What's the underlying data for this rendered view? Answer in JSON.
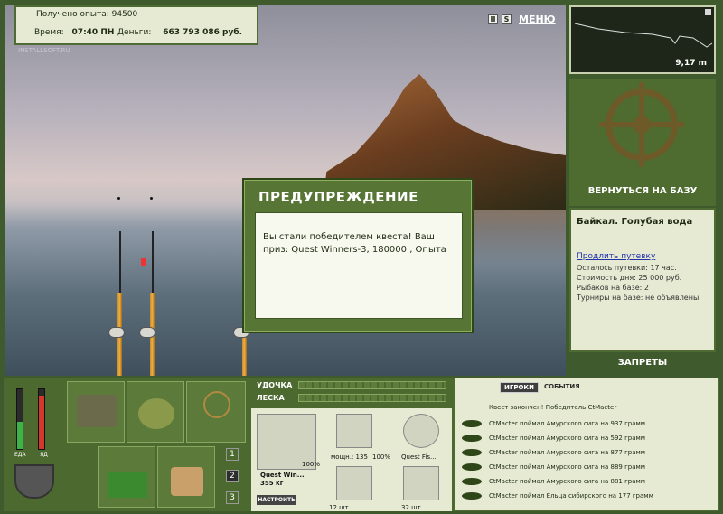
{
  "hud": {
    "experience_label": "Получено опыта:",
    "experience_value": "94500",
    "time_label": "Время:",
    "time_value": "07:40 ПН",
    "money_label": "Деньги:",
    "money_value": "663 793 086 руб.",
    "watermark": "INSTALLSOFT.RU"
  },
  "top_bar": {
    "pause_glyph": "II",
    "sound_glyph": "S",
    "menu_label": "МЕНЮ"
  },
  "depth": {
    "value": "9,17 m"
  },
  "dialog": {
    "title": "ПРЕДУПРЕЖДЕНИЕ",
    "message": "Вы стали победителем квеста! Ваш приз: Quest Winners-3, 180000 , Опыта"
  },
  "right_panel": {
    "return_label": "ВЕРНУТЬСЯ НА БАЗУ",
    "location_title": "Байкал. Голубая вода",
    "extend_link": "Продлить путевку",
    "remaining": "Осталось путевки: 17 час.",
    "day_cost": "Стоимость дня: 25 000 руб.",
    "fishers": "Рыбаков на базе: 2",
    "tournaments": "Турниры на базе: не объявлены",
    "bans_label": "ЗАПРЕТЫ"
  },
  "meters": {
    "food_label": "ЕДА",
    "poison_label": "ЯД",
    "food_level": 0.45,
    "poison_level": 0.9
  },
  "slot_tabs": [
    "1",
    "2",
    "3"
  ],
  "tackle": {
    "rod_label": "УДОЧКА",
    "line_label": "ЛЕСКА",
    "rod_name": "Quest Win...",
    "rod_weight": "355 кг",
    "rod_percent": "100%",
    "reel_power": "мощн.: 135",
    "reel_percent": "100%",
    "line_name": "Quest Fis...",
    "hook_count": "12 шт.",
    "bait_count": "32 шт.",
    "configure_label": "НАСТРОИТЬ"
  },
  "events": {
    "tab_players": "ИГРОКИ",
    "tab_events": "СОБЫТИЯ",
    "quest_done": "Квест закончен! Победитель CtMacter",
    "feed": [
      "CtMacter поймал Амурского сига на 937 грамм",
      "CtMacter поймал Амурского сига на 592 грамм",
      "CtMacter поймал Амурского сига на 877 грамм",
      "CtMacter поймал Амурского сига на 889 грамм",
      "CtMacter поймал Амурского сига на 881 грамм",
      "CtMacter поймал Ельца сибирского на 177 грамм"
    ]
  }
}
